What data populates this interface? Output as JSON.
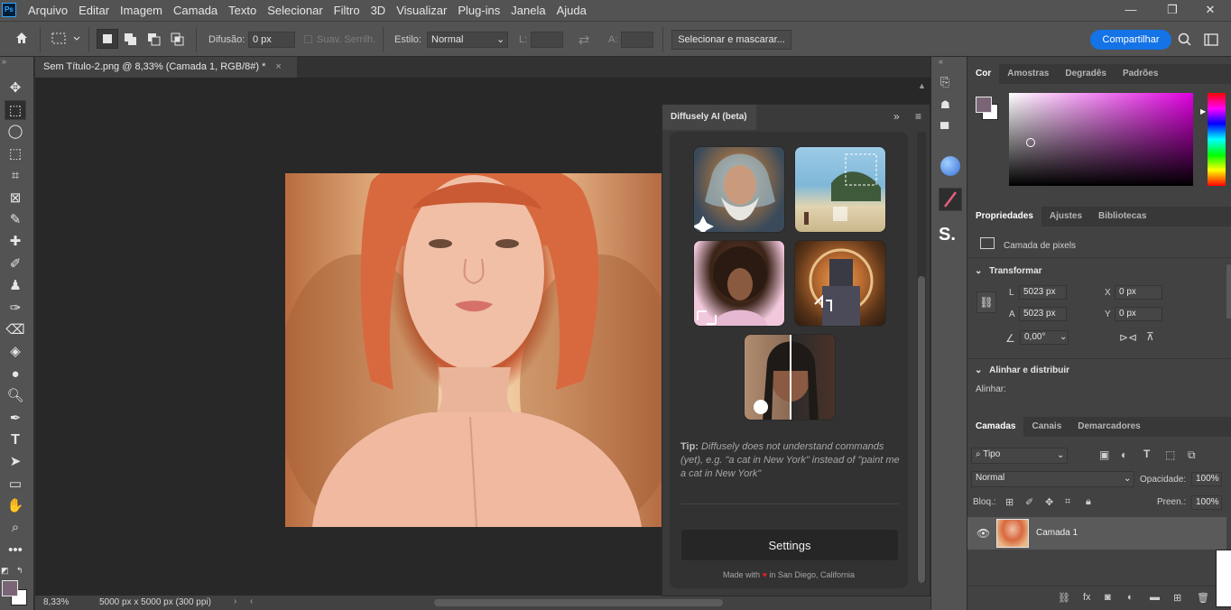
{
  "menubar": {
    "logo": "Ps",
    "items": [
      "Arquivo",
      "Editar",
      "Imagem",
      "Camada",
      "Texto",
      "Selecionar",
      "Filtro",
      "3D",
      "Visualizar",
      "Plug-ins",
      "Janela",
      "Ajuda"
    ],
    "window_buttons": [
      "—",
      "❐",
      "✕"
    ]
  },
  "options": {
    "difusao_label": "Difusão:",
    "difusao_value": "0 px",
    "suav_label": "Suav. Serrilh.",
    "estilo_label": "Estilo:",
    "estilo_value": "Normal",
    "l_label": "L:",
    "a_label": "A:",
    "select_mask_button": "Selecionar e mascarar...",
    "share_button": "Compartilhar"
  },
  "document": {
    "tab_title": "Sem Título-2.png @ 8,33% (Camada 1, RGB/8#) *",
    "zoom": "8,33%",
    "size_info": "5000 px x 5000 px (300 ppi)"
  },
  "plugin": {
    "tab_title": "Diffusely AI (beta)",
    "tip_label": "Tip:",
    "tip_text": "Diffusely does not understand commands (yet), e.g. \"a cat in New York\" instead of \"paint me a cat in New York\"",
    "settings_button": "Settings",
    "footer_before": "Made with",
    "footer_after": "in San Diego, California"
  },
  "color_panel": {
    "tabs": [
      "Cor",
      "Amostras",
      "Degradês",
      "Padrões"
    ],
    "foreground": "#7a6577",
    "background": "#ffffff",
    "hue": "#e000e0"
  },
  "properties": {
    "tabs": [
      "Propriedades",
      "Ajustes",
      "Bibliotecas"
    ],
    "layer_kind": "Camada de pixels",
    "transform_title": "Transformar",
    "l_label": "L",
    "l_value": "5023 px",
    "a_label": "A",
    "a_value": "5023 px",
    "x_label": "X",
    "x_value": "0 px",
    "y_label": "Y",
    "y_value": "0 px",
    "angle_value": "0,00°",
    "align_title": "Alinhar e distribuir",
    "align_sub": "Alinhar:"
  },
  "layers": {
    "tabs": [
      "Camadas",
      "Canais",
      "Demarcadores"
    ],
    "filter_value": "Tipo",
    "blend_mode": "Normal",
    "opacity_label": "Opacidade:",
    "opacity_value": "100%",
    "lock_label": "Bloq.:",
    "fill_label": "Preen.:",
    "fill_value": "100%",
    "layer_name": "Camada 1"
  }
}
